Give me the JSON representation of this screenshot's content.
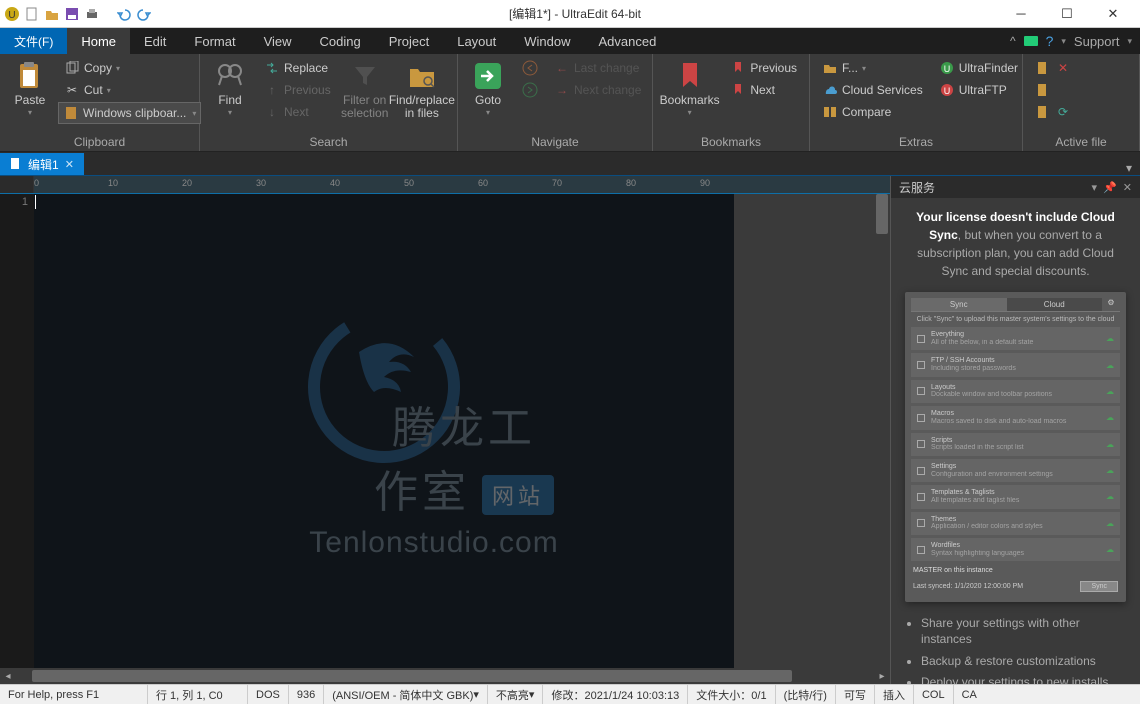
{
  "titlebar": {
    "title": "[编辑1*] - UltraEdit 64-bit"
  },
  "menubar": {
    "file": "文件(F)",
    "items": [
      "Home",
      "Edit",
      "Format",
      "View",
      "Coding",
      "Project",
      "Layout",
      "Window",
      "Advanced"
    ],
    "active_index": 0,
    "support": "Support"
  },
  "ribbon": {
    "clipboard": {
      "label": "Clipboard",
      "paste": "Paste",
      "copy": "Copy",
      "cut": "Cut",
      "windows_clipboard": "Windows clipboar..."
    },
    "search": {
      "label": "Search",
      "find": "Find",
      "replace": "Replace",
      "previous": "Previous",
      "next": "Next",
      "filter": "Filter on\nselection",
      "findinfiles": "Find/replace\nin files"
    },
    "navigate": {
      "label": "Navigate",
      "goto": "Goto",
      "last_change": "Last change",
      "next_change": "Next change"
    },
    "bookmarks": {
      "label": "Bookmarks",
      "bookmarks": "Bookmarks",
      "previous": "Previous",
      "next": "Next"
    },
    "extras": {
      "label": "Extras",
      "f": "F...",
      "cloud_services": "Cloud Services",
      "compare": "Compare",
      "ultrafinder": "UltraFinder",
      "ultraftp": "UltraFTP"
    },
    "activefile": {
      "label": "Active file"
    }
  },
  "tabs": {
    "items": [
      {
        "label": "编辑1",
        "modified": true
      }
    ]
  },
  "ruler": {
    "marks": [
      "0",
      "10",
      "20",
      "30",
      "40",
      "50",
      "60",
      "70",
      "80",
      "90"
    ]
  },
  "gutter": {
    "line1": "1"
  },
  "watermark": {
    "cn": "腾龙工作室",
    "badge": "网站",
    "en": "Tenlonstudio.com"
  },
  "sidepanel": {
    "title": "云服务",
    "msg_bold": "Your license doesn't include Cloud Sync",
    "msg_rest": ", but when you convert to a subscription plan, you can add Cloud Sync and special discounts.",
    "preview": {
      "tab_sync": "Sync",
      "tab_cloud": "Cloud",
      "desc": "Click \"Sync\" to upload this master system's settings to the cloud",
      "items": [
        {
          "title": "Everything",
          "sub": "All of the below, in a default state"
        },
        {
          "title": "FTP / SSH Accounts",
          "sub": "Including stored passwords"
        },
        {
          "title": "Layouts",
          "sub": "Dockable window and toolbar positions"
        },
        {
          "title": "Macros",
          "sub": "Macros saved to disk and auto-load macros"
        },
        {
          "title": "Scripts",
          "sub": "Scripts loaded in the script list"
        },
        {
          "title": "Settings",
          "sub": "Configuration and environment settings"
        },
        {
          "title": "Templates & Taglists",
          "sub": "All templates and taglist files"
        },
        {
          "title": "Themes",
          "sub": "Application / editor colors and styles"
        },
        {
          "title": "Wordfiles",
          "sub": "Syntax highlighting languages"
        }
      ],
      "master": "MASTER on this instance",
      "lastsync": "Last synced: 1/1/2020 12:00:00 PM",
      "sync_btn": "Sync"
    },
    "bullets": [
      "Share your settings with other instances",
      "Backup & restore customizations",
      "Deploy your settings to new installs"
    ]
  },
  "statusbar": {
    "help": "For Help, press F1",
    "pos": "行 1, 列 1, C0",
    "eol": "DOS",
    "cp": "936",
    "enc": "(ANSI/OEM - 简体中文 GBK)",
    "hl": "不高亮",
    "modified": "修改：2021/1/24 10:03:13",
    "size": "文件大小：0/1",
    "unit": "(比特/行)",
    "rw": "可写",
    "ins": "插入",
    "col": "COL",
    "cap": "CA"
  }
}
